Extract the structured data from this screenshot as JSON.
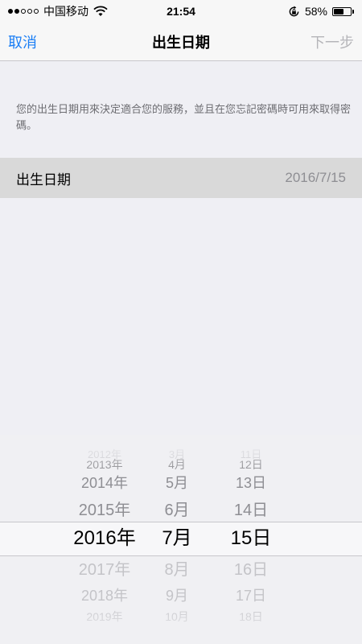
{
  "status": {
    "carrier": "中国移动",
    "time": "21:54",
    "battery": "58%"
  },
  "nav": {
    "cancel": "取消",
    "title": "出生日期",
    "next": "下一步"
  },
  "explain": "您的出生日期用來決定適合您的服務，並且在您忘記密碼時可用來取得密碼。",
  "birthday": {
    "label": "出生日期",
    "value": "2016/7/15"
  },
  "picker": {
    "years": [
      "2012年",
      "2013年",
      "2014年",
      "2015年",
      "2016年",
      "2017年",
      "2018年",
      "2019年"
    ],
    "months": [
      "3月",
      "4月",
      "5月",
      "6月",
      "7月",
      "8月",
      "9月",
      "10月"
    ],
    "days": [
      "11日",
      "12日",
      "13日",
      "14日",
      "15日",
      "16日",
      "17日",
      "18日"
    ],
    "selected_index": 4
  }
}
